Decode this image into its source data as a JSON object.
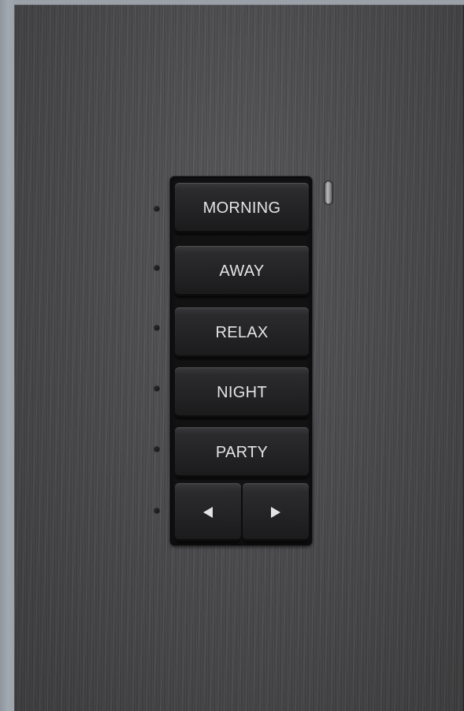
{
  "keypad": {
    "buttons": [
      {
        "label": "MORNING"
      },
      {
        "label": "AWAY"
      },
      {
        "label": "RELAX"
      },
      {
        "label": "NIGHT"
      },
      {
        "label": "PARTY"
      }
    ],
    "arrow_left_icon": "arrow-left-icon",
    "arrow_right_icon": "arrow-right-icon",
    "sensor_icon": "light-sensor-icon"
  },
  "colors": {
    "faceplate": "#4d4d4f",
    "key": "#222224",
    "label": "#e4e4e6"
  }
}
